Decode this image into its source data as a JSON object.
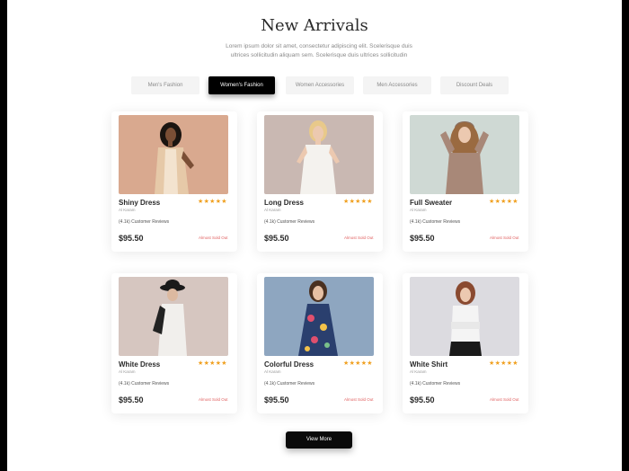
{
  "section": {
    "title": "New Arrivals",
    "subtitle_line1": "Lorem ipsum dolor sit amet, consectetur adipiscing elit. Scelerisque duis",
    "subtitle_line2": "ultrices sollicitudin aliquam sem. Scelerisque duis ultrices sollicitudin"
  },
  "tabs": [
    {
      "label": "Men's Fashion",
      "active": false
    },
    {
      "label": "Women's Fashion",
      "active": true
    },
    {
      "label": "Women Accessories",
      "active": false
    },
    {
      "label": "Men Accessories",
      "active": false
    },
    {
      "label": "Discount Deals",
      "active": false
    }
  ],
  "products": [
    {
      "name": "Shiny Dress",
      "brand": "Al Karam",
      "rating_stars": "★★★★★",
      "reviews": "(4.1k) Customer Reviews",
      "price": "$95.50",
      "stock": "Almost Sold Out",
      "image_icon": "woman-beige-blazer-photo"
    },
    {
      "name": "Long Dress",
      "brand": "Al Karam",
      "rating_stars": "★★★★★",
      "reviews": "(4.1k) Customer Reviews",
      "price": "$95.50",
      "stock": "Almost Sold Out",
      "image_icon": "woman-white-dress-photo"
    },
    {
      "name": "Full Sweater",
      "brand": "Al Karam",
      "rating_stars": "★★★★★",
      "reviews": "(4.1k) Customer Reviews",
      "price": "$95.50",
      "stock": "Almost Sold Out",
      "image_icon": "woman-sweater-photo"
    },
    {
      "name": "White Dress",
      "brand": "Al Karam",
      "rating_stars": "★★★★★",
      "reviews": "(4.1k) Customer Reviews",
      "price": "$95.50",
      "stock": "Almost Sold Out",
      "image_icon": "woman-hat-white-outfit-photo"
    },
    {
      "name": "Colorful Dress",
      "brand": "Al Karam",
      "rating_stars": "★★★★★",
      "reviews": "(4.1k) Customer Reviews",
      "price": "$95.50",
      "stock": "Almost Sold Out",
      "image_icon": "woman-floral-dress-photo"
    },
    {
      "name": "White Shirt",
      "brand": "Al Karam",
      "rating_stars": "★★★★★",
      "reviews": "(4.1k) Customer Reviews",
      "price": "$95.50",
      "stock": "Almost Sold Out",
      "image_icon": "woman-white-top-photo"
    }
  ],
  "view_more_label": "View More",
  "colors": {
    "accent": "#000000",
    "star": "#f0a020",
    "stock_warning": "#e06060"
  }
}
